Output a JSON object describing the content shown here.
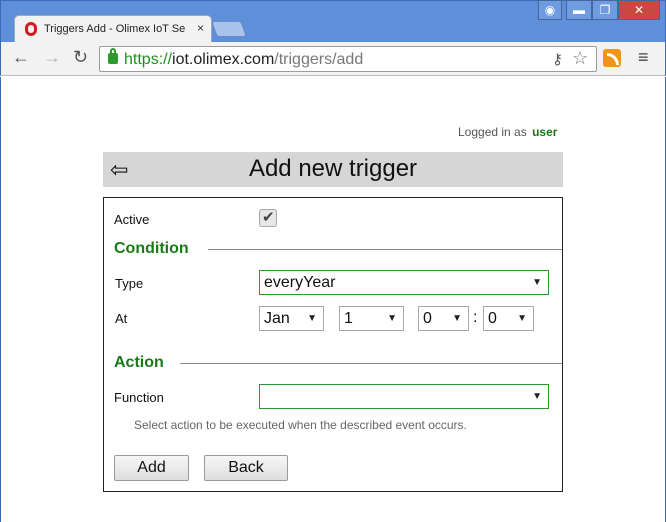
{
  "browser": {
    "tab_title": "Triggers Add - Olimex IoT Se",
    "tab_close": "×",
    "url_scheme": "https://",
    "url_host": "iot.olimex.com",
    "url_path": "/triggers/add",
    "window_buttons": {
      "user": "◉",
      "minimize": "▬",
      "maximize": "❐",
      "close": "✕"
    },
    "nav": {
      "back": "←",
      "forward": "→",
      "reload": "↻"
    },
    "icons": {
      "key": "⚷",
      "star": "☆",
      "menu": "≡"
    }
  },
  "session": {
    "prefix": "Logged in as",
    "user": "user"
  },
  "header": {
    "back_glyph": "⇦",
    "title": "Add new trigger"
  },
  "form": {
    "active_label": "Active",
    "active_checked": true,
    "check_glyph": "✔",
    "condition_title": "Condition",
    "type_label": "Type",
    "type_value": "everyYear",
    "at_label": "At",
    "at_month": "Jan",
    "at_day": "1",
    "at_hour": "0",
    "at_minute": "0",
    "time_separator": ":",
    "action_title": "Action",
    "function_label": "Function",
    "function_value": "",
    "hint": "Select action to be executed when the described event occurs.",
    "add_label": "Add",
    "back_label": "Back"
  },
  "colors": {
    "accent_green": "#1a7a1a",
    "header_bg": "#d6d6d6",
    "chrome_blue": "#5f8fd9"
  }
}
